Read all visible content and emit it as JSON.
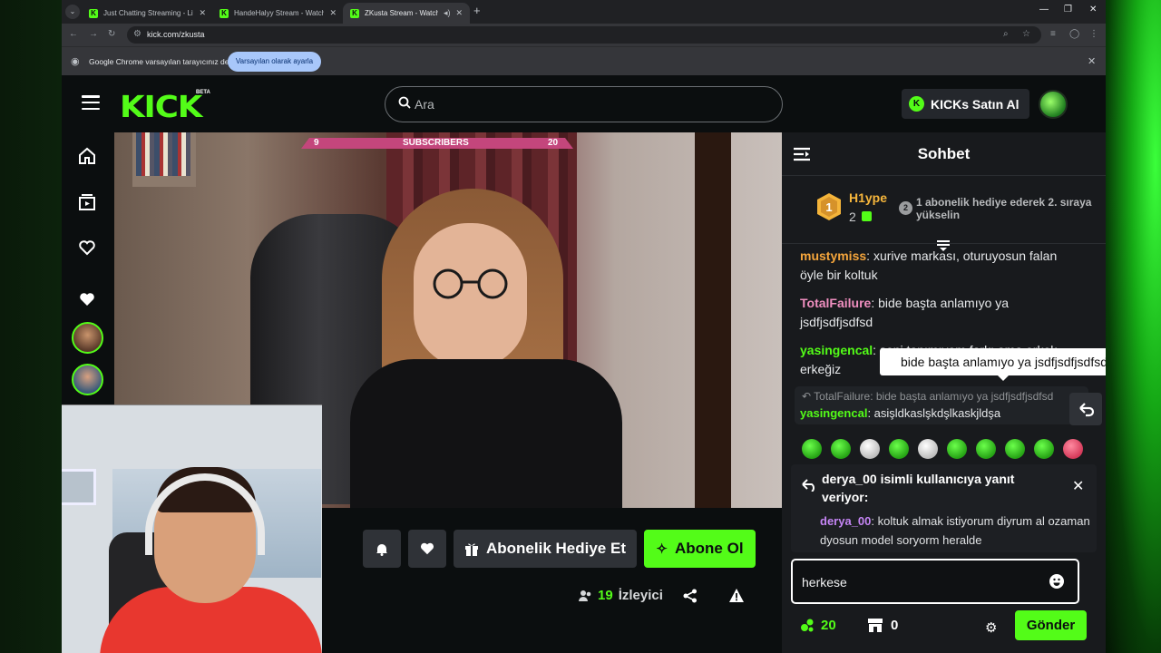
{
  "browser": {
    "tabs": [
      {
        "title": "Just Chatting Streaming - Live"
      },
      {
        "title": "HandeHalyy Stream - Watch Li"
      },
      {
        "title": "ZKusta Stream - Watch Live"
      }
    ],
    "url": "kick.com/zkusta",
    "infobar_text": "Google Chrome varsayılan tarayıcınız değil",
    "infobar_button": "Varsayılan olarak ayarla"
  },
  "header": {
    "logo": "KICK",
    "beta": "BETA",
    "search_placeholder": "Ara",
    "kicks_button": "KICKs Satın Al"
  },
  "video": {
    "subscribers_label": "SUBSCRIBERS",
    "sub_left": "9",
    "sub_right": "20"
  },
  "actions": {
    "gift_sub": "Abonelik Hediye Et",
    "subscribe": "Abone Ol",
    "viewer_count": "19",
    "viewer_label": "İzleyici"
  },
  "chat": {
    "title": "Sohbet",
    "leaderboard": {
      "rank": "1",
      "name": "H1ype",
      "count": "2",
      "next_rank": "2",
      "next_text": "1 abonelik hediye ederek 2. sıraya yükselin"
    },
    "messages": [
      {
        "user": "mustymiss",
        "color": "#f6a63c",
        "text": "xurive markası, oturuyosun falan öyle bir koltuk"
      },
      {
        "user": "TotalFailure",
        "color": "#f08fc0",
        "text": "bide başta anlamıyo ya jsdfjsdfjsdfsd"
      },
      {
        "user": "yasingencal",
        "color": "#53fc18",
        "text": "şeni tanımıyom farkı ama erkek erkeğiz"
      }
    ],
    "tooltip": "bide başta anlamıyo ya jsdfjsdfjsdfsd",
    "reply_ref": "TotalFailure: bide başta anlamıyo ya jsdfjsdfjsdfsd",
    "reply_user": "yasingencal",
    "reply_text": "asişldkaslşkdşlkaskjldşa",
    "replying_to": "derya_00 isimli kullanıcıya yanıt veriyor:",
    "reply_target_user": "derya_00",
    "reply_target_text": "koltuk almak istiyorum diyrum al ozaman dyosun model soryorm heralde",
    "input_value": "herkese",
    "points": "20",
    "shop_count": "0",
    "send": "Gönder"
  },
  "colors": {
    "accent": "#53fc18",
    "chat_bg": "#181a1d",
    "page_bg": "#0b0e0f"
  }
}
